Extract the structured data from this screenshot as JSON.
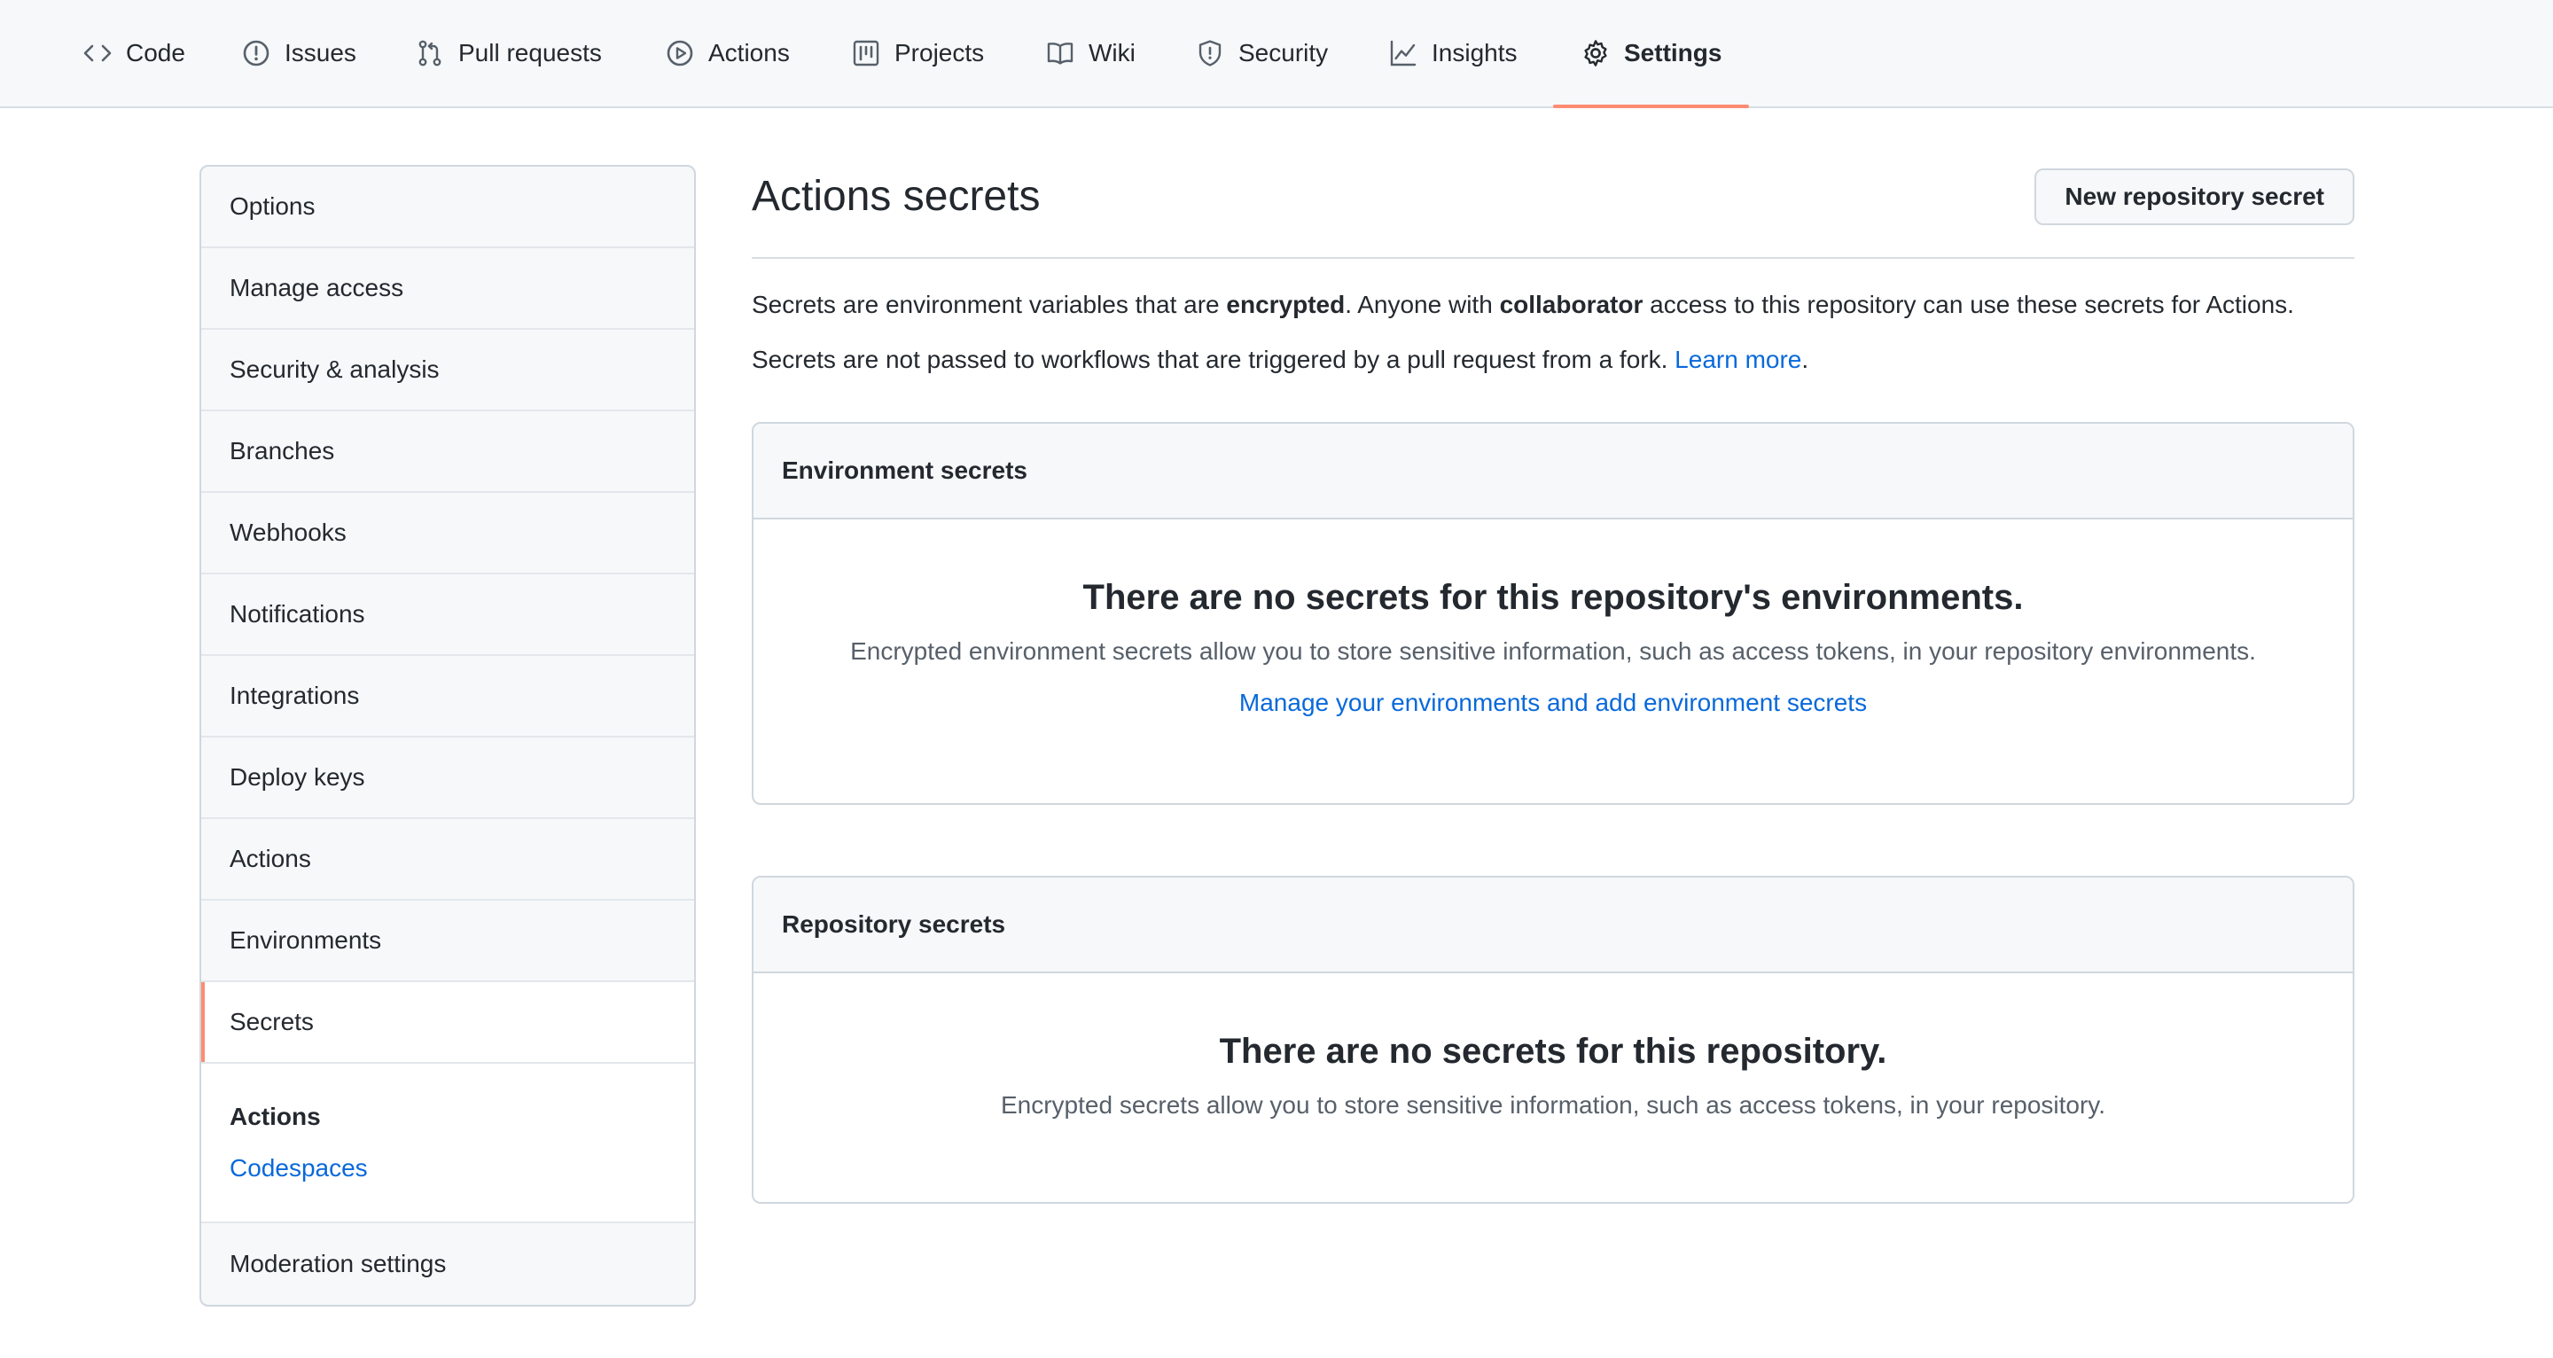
{
  "repo_nav": {
    "tabs": [
      {
        "label": "Code",
        "icon": "code-icon"
      },
      {
        "label": "Issues",
        "icon": "issue-icon"
      },
      {
        "label": "Pull requests",
        "icon": "pull-request-icon"
      },
      {
        "label": "Actions",
        "icon": "play-icon"
      },
      {
        "label": "Projects",
        "icon": "project-icon"
      },
      {
        "label": "Wiki",
        "icon": "book-icon"
      },
      {
        "label": "Security",
        "icon": "shield-icon"
      },
      {
        "label": "Insights",
        "icon": "graph-icon"
      },
      {
        "label": "Settings",
        "icon": "gear-icon",
        "selected": true
      }
    ]
  },
  "sidebar": {
    "items": [
      {
        "label": "Options"
      },
      {
        "label": "Manage access"
      },
      {
        "label": "Security & analysis"
      },
      {
        "label": "Branches"
      },
      {
        "label": "Webhooks"
      },
      {
        "label": "Notifications"
      },
      {
        "label": "Integrations"
      },
      {
        "label": "Deploy keys"
      },
      {
        "label": "Actions"
      },
      {
        "label": "Environments"
      },
      {
        "label": "Secrets",
        "selected": true
      }
    ],
    "group": {
      "heading": "Actions",
      "link": "Codespaces"
    },
    "last_item": "Moderation settings"
  },
  "main": {
    "title": "Actions secrets",
    "new_button": "New repository secret",
    "desc1": {
      "p1": "Secrets are environment variables that are ",
      "b1": "encrypted",
      "p2": ". Anyone with ",
      "b2": "collaborator",
      "p3": " access to this repository can use these secrets for Actions."
    },
    "desc2": {
      "p1": "Secrets are not passed to workflows that are triggered by a pull request from a fork. ",
      "link": "Learn more",
      "p2": "."
    },
    "env_box": {
      "header": "Environment secrets",
      "blank_title": "There are no secrets for this repository's environments.",
      "blank_desc": "Encrypted environment secrets allow you to store sensitive information, such as access tokens, in your repository environments.",
      "blank_link": "Manage your environments and add environment secrets"
    },
    "repo_box": {
      "header": "Repository secrets",
      "blank_title": "There are no secrets for this repository.",
      "blank_desc": "Encrypted secrets allow you to store sensitive information, such as access tokens, in your repository."
    }
  },
  "colors": {
    "accent_underline": "#fd8c73",
    "link": "#0969da",
    "border": "#d0d7de"
  }
}
